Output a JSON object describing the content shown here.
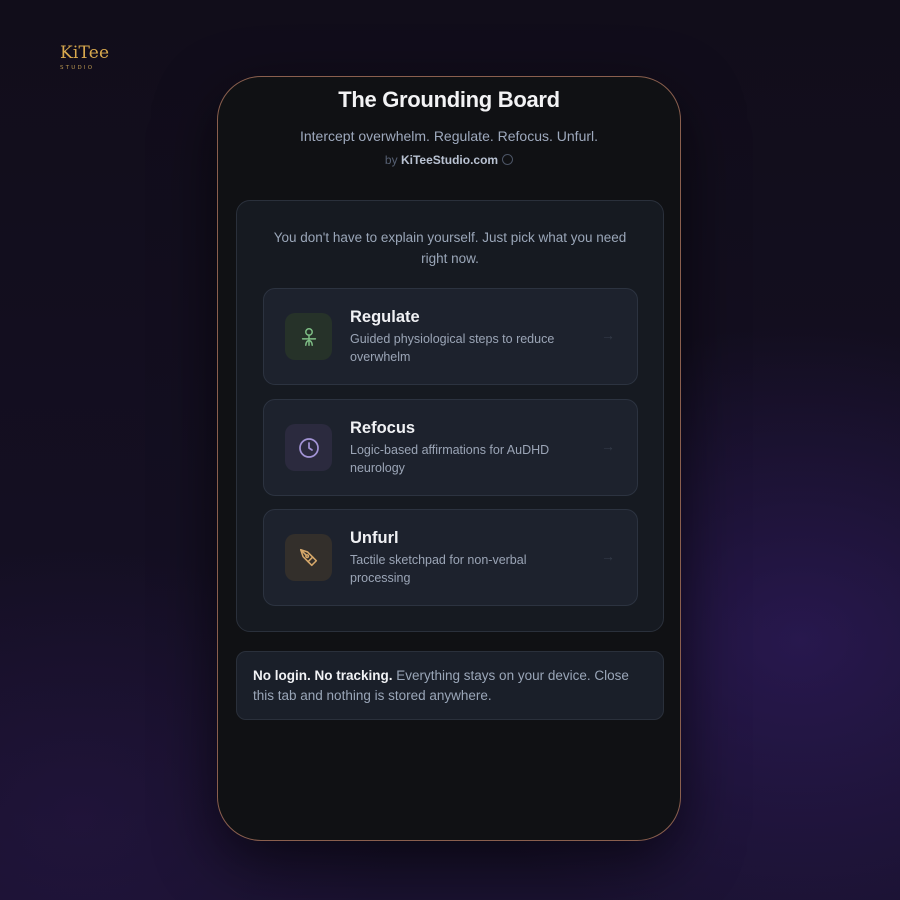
{
  "brand": {
    "name": "KiTee",
    "sub": "STUDIO"
  },
  "app": {
    "title": "The Grounding Board",
    "subtitle": "Intercept overwhelm. Regulate. Refocus. Unfurl.",
    "byline_prefix": "by",
    "byline_site": "KiTeeStudio.com"
  },
  "prompt": "You don't have to explain yourself. Just pick what you need right now.",
  "options": [
    {
      "title": "Regulate",
      "description": "Guided physiological steps to reduce overwhelm",
      "icon": "person-icon",
      "icon_color": "#7fbf86",
      "icon_bg": "#263229"
    },
    {
      "title": "Refocus",
      "description": "Logic-based affirmations for AuDHD neurology",
      "icon": "clock-icon",
      "icon_color": "#a394d6",
      "icon_bg": "#2b2a3e"
    },
    {
      "title": "Unfurl",
      "description": "Tactile sketchpad for non-verbal processing",
      "icon": "pen-nib-icon",
      "icon_color": "#d6a86a",
      "icon_bg": "#332f2b"
    }
  ],
  "privacy": {
    "strong": "No login. No tracking.",
    "text": " Everything stays on your device. Close this tab and nothing is stored anywhere."
  },
  "colors": {
    "frame_border": "#8a5f4e",
    "brand_gold": "#d9a94e",
    "background": "#120e1d"
  }
}
